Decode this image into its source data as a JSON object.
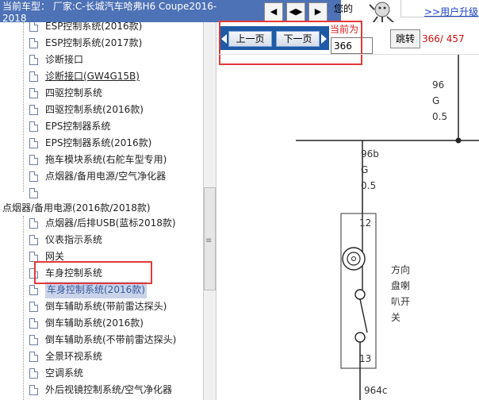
{
  "header": {
    "title_line1": "当前车型：  厂家:C-长城汽车哈弗H6 Coupe2016-",
    "title_line2": "2018",
    "nav_buttons": [
      "◀",
      "◀▶",
      "▶"
    ],
    "greeting": "您的",
    "upgrade_link": ">>用户升级"
  },
  "tree": {
    "items_top": [
      {
        "label": "ESP控制系统(2016款)"
      },
      {
        "label": "ESP控制系统(2017款)"
      },
      {
        "label": "诊断接口"
      },
      {
        "label": "诊断接口(GW4G15B)"
      },
      {
        "label": "四驱控制系统"
      },
      {
        "label": "四驱控制系统(2016款)"
      },
      {
        "label": "EPS控制器系统"
      },
      {
        "label": "EPS控制器系统(2016款)"
      },
      {
        "label": "拖车模块系统(右舵车型专用)"
      },
      {
        "label": "点烟器/备用电源/空气净化器"
      },
      {
        "label": ""
      }
    ],
    "folder_label": "点烟器/备用电源(2016款/2018款)",
    "items_bottom": [
      {
        "label": "点烟器/后排USB(蓝标2018款)"
      },
      {
        "label": "仪表指示系统"
      },
      {
        "label": "网关"
      },
      {
        "label": "车身控制系统"
      },
      {
        "label": "车身控制系统(2016款)"
      },
      {
        "label": "倒车辅助系统(带前雷达探头)"
      },
      {
        "label": "倒车辅助系统(2016款)"
      },
      {
        "label": "倒车辅助系统(不带前雷达探头)"
      },
      {
        "label": "全景环视系统"
      },
      {
        "label": "空调系统"
      },
      {
        "label": "外后视镜控制系统/空气净化器"
      }
    ]
  },
  "pager": {
    "prev_label": "上一页",
    "next_label": "下一页",
    "current_label": "当前为",
    "current_value": "366",
    "jump_label": "跳转",
    "page_count": "366/ 457"
  },
  "diagram": {
    "wire_top": {
      "num": "96",
      "color": "G",
      "size": "0.5"
    },
    "wire_mid": {
      "num": "96b",
      "color": "G",
      "size": "0.5"
    },
    "pin_top": "12",
    "pin_bottom": "13",
    "component_lines": [
      "方向",
      "盘喇",
      "叭开",
      "关"
    ],
    "wire_bottom": "964c"
  }
}
